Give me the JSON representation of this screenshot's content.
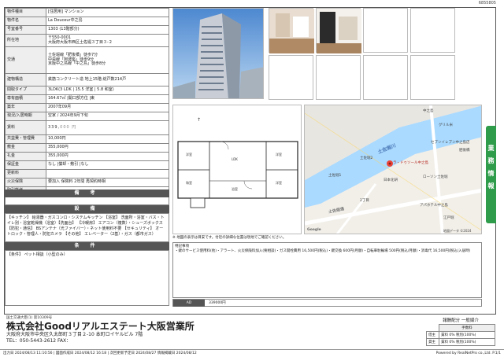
{
  "doc_code": "6855805",
  "property": {
    "rows": [
      {
        "label": "物件種目",
        "value": "[住居用]  マンション"
      },
      {
        "label": "物件名",
        "value": "La Douceur中之島"
      },
      {
        "label": "号室番号",
        "value": "1303  (13階部分)"
      },
      {
        "label": "所在地",
        "value": "〒550-0001\n大阪府大阪市西区土佐堀３丁目３-２"
      },
      {
        "label": "交通",
        "value": "土佐堀線「肥後橋」徒歩7分\n中央線「阿波座」徒歩9分\n京阪中之島線「中之島」徒歩8分"
      },
      {
        "label": "建物構造",
        "value": "鉄筋コンクリート造  地上15階  総戸数214戸"
      },
      {
        "label": "間取タイプ",
        "value": "3LDK(3 LDK  | 15.5 洋室 | 5.8 和室)"
      },
      {
        "label": "専有面積",
        "value": "164.67㎡    |開口部方位  |東"
      },
      {
        "label": "築年",
        "value": "2007年09月"
      },
      {
        "label": "現況/入居時期",
        "value": "空家 / 2024年9月下旬"
      },
      {
        "label": "賃料",
        "value": "339,000 円"
      },
      {
        "label": "共益費・管理費",
        "value": "10,000円"
      },
      {
        "label": "敷金",
        "value": "355,000円"
      },
      {
        "label": "礼金",
        "value": "355,000円"
      },
      {
        "label": "保証金",
        "value": "なし    |償却・敷引  |なし"
      },
      {
        "label": "更新料",
        "value": ""
      },
      {
        "label": "火災保険",
        "value": "要加入  保険料 2年間  再契約時相"
      },
      {
        "label": "取引態様",
        "value": ""
      },
      {
        "label": "所有会社",
        "value": ""
      }
    ],
    "rent_prefix": "339,",
    "rent_suffix": "000 円"
  },
  "sections": {
    "remarks_title": "備 考",
    "facilities_title": "設 備",
    "facilities_text": "【キッチン】 給湯器・ガスコンロ・システムキッチン 【浴室】 洗面所・浴室・バス・トイレ別・浴室乾燥機（浴室）【洗面台】 【冷暖房】 エアコン（複数）・シューズボックス 【防犯・通信】 BSアンテナ（光ファイバー）・ネット使用料不要 【セキュリティ】 オートロック・管理人・防犯カメラ 【その他】 エレベーター（2基）・ガス（都市ガス）",
    "conditions_title": "条 件",
    "conditions_text": "【条件】 ペット相談（小型のみ）"
  },
  "special": {
    "title": "特記事項",
    "text": "・鍵のサービス使用料(他)・アラート、火災保険料加入(要相談)・ガス開栓費用 16,500円(税込)・鍵交換 600円(月額)・自転車駐輪場 500円(税込/月額)・消毒代 16,500円(税込/入居時)"
  },
  "ad": {
    "label": "AD",
    "value": "339000円"
  },
  "map": {
    "note": "※ 地図の表示は目安です。付近の詳細な位置は現地でご確認ください。",
    "labels": [
      "中之島",
      "土佐堀川",
      "グリル米",
      "セブンイレブン中之島店",
      "肥後橋",
      "土佐堀2",
      "ラ・ドゥソール中之島",
      "ローソン土佐堀",
      "2丁目",
      "日本化研",
      "土佐堀通",
      "江戸堀",
      "土佐堀1",
      "アパホテル中之島"
    ],
    "river_label": "土佐堀川",
    "road_label": "土佐堀通",
    "google": "Google",
    "copyright": "地図データ ©2024"
  },
  "floorplan": {
    "labels": [
      "LDK",
      "洋室",
      "和室",
      "洋室",
      "洋室",
      "浴室"
    ]
  },
  "side_tab": "業務情報",
  "company": {
    "license": "国土交通大臣(1) 第10309号",
    "name": "株式会社Goodリアルエステート大阪営業所",
    "address": "大阪府大阪市中央区久太郎町３丁目２-10  本町ロイヤルビル 7階",
    "tel": "TEL：050-5443-2612  FAX："
  },
  "fees": {
    "title": "報酬配分  一般媒介",
    "header": "手数料",
    "rows": [
      {
        "label": "借主",
        "value": "賃料 0% 税別(100%)"
      },
      {
        "label": "貸主",
        "value": "賃料 0% 税別(100%)"
      }
    ]
  },
  "footer": {
    "left": "出力日 2024/08/13 11:10:56  |  図面作成日 2024/08/12 16:18  |  次回更新予定日 2024/08/27  情報掲載日 2024/08/12",
    "right": "Powered by RealNetPro co.,Ltd.   P.1/1"
  }
}
